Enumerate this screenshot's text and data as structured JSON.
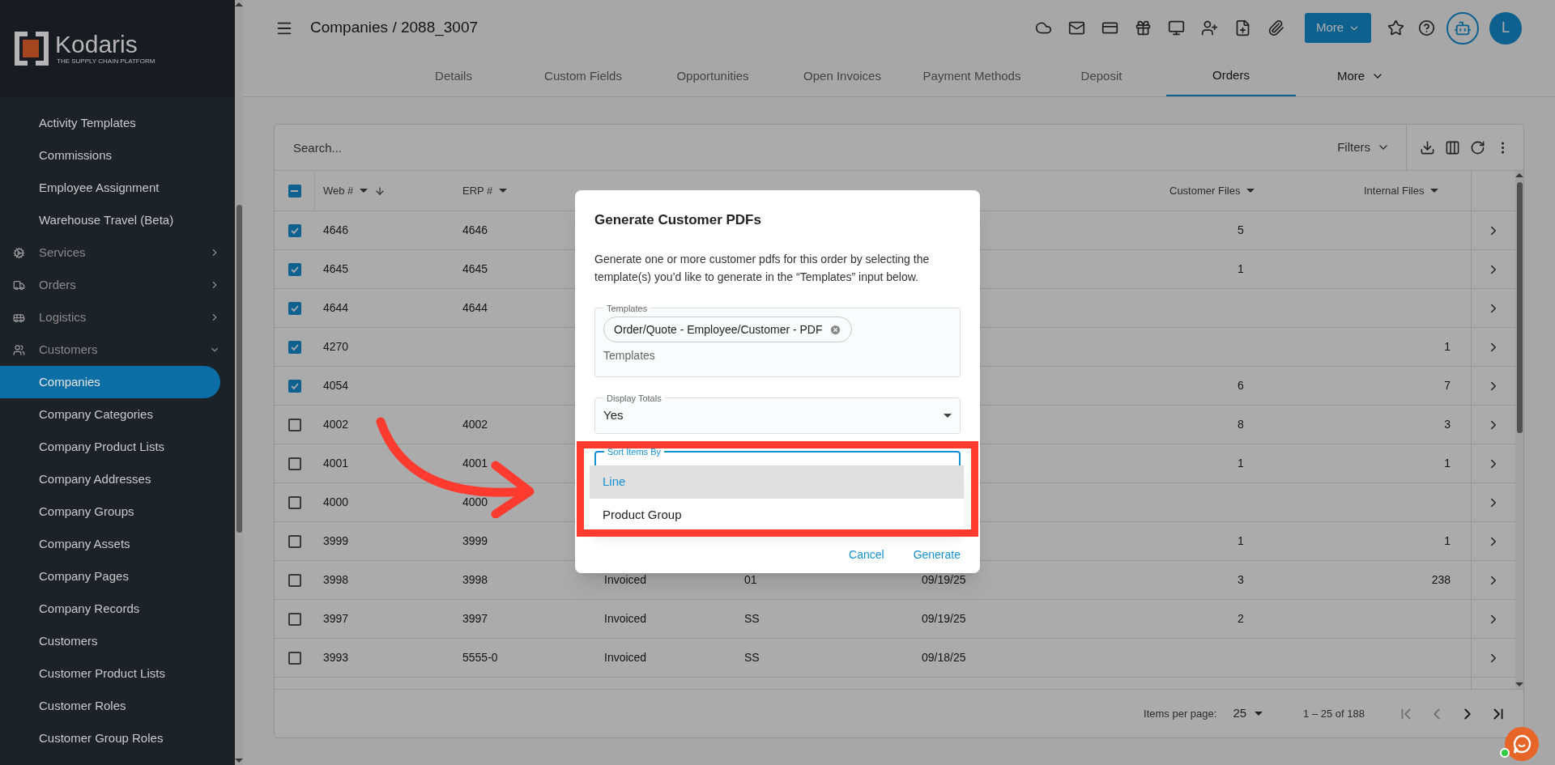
{
  "sidebar": {
    "logo": {
      "name": "Kodaris",
      "tagline": "THE SUPPLY CHAIN PLATFORM"
    },
    "items": [
      {
        "label": "Activity Templates",
        "kind": "link",
        "selected": false
      },
      {
        "label": "Commissions",
        "kind": "link",
        "selected": false
      },
      {
        "label": "Employee Assignment",
        "kind": "link",
        "selected": false
      },
      {
        "label": "Warehouse Travel (Beta)",
        "kind": "link",
        "selected": false
      },
      {
        "label": "Services",
        "kind": "group",
        "expanded": false
      },
      {
        "label": "Orders",
        "kind": "group",
        "expanded": false
      },
      {
        "label": "Logistics",
        "kind": "group",
        "expanded": false
      },
      {
        "label": "Customers",
        "kind": "group",
        "expanded": true,
        "children": [
          {
            "label": "Companies",
            "selected": true
          },
          {
            "label": "Company Categories",
            "selected": false
          },
          {
            "label": "Company Product Lists",
            "selected": false
          },
          {
            "label": "Company Addresses",
            "selected": false
          },
          {
            "label": "Company Groups",
            "selected": false
          },
          {
            "label": "Company Assets",
            "selected": false
          },
          {
            "label": "Company Pages",
            "selected": false
          },
          {
            "label": "Company Records",
            "selected": false
          },
          {
            "label": "Customers",
            "selected": false
          },
          {
            "label": "Customer Product Lists",
            "selected": false
          },
          {
            "label": "Customer Roles",
            "selected": false
          },
          {
            "label": "Customer Group Roles",
            "selected": false
          }
        ]
      }
    ]
  },
  "header": {
    "title": "Companies / 2088_3007",
    "more_button": "More",
    "avatar": "L"
  },
  "tabs": [
    {
      "label": "Details",
      "kind": "tab",
      "selected": false
    },
    {
      "label": "Custom Fields",
      "kind": "tab",
      "selected": false
    },
    {
      "label": "Opportunities",
      "kind": "tab",
      "selected": false
    },
    {
      "label": "Open Invoices",
      "kind": "tab",
      "selected": false
    },
    {
      "label": "Payment Methods",
      "kind": "tab",
      "selected": false
    },
    {
      "label": "Deposit",
      "kind": "tab",
      "selected": false
    },
    {
      "label": "Orders",
      "kind": "tab",
      "selected": true
    },
    {
      "label": "More",
      "kind": "menu",
      "selected": false
    }
  ],
  "table": {
    "search": {
      "placeholder": "Search..."
    },
    "filters": "Filters",
    "select_all_partial": true,
    "columns": [
      {
        "label": "Web #",
        "sort_arrow": true
      },
      {
        "label": "ERP #",
        "sort_arrow": false
      },
      null,
      null,
      null,
      {
        "label": "Customer Files",
        "sort_arrow": false
      },
      {
        "label": "Internal Files",
        "sort_arrow": false
      }
    ],
    "rows": [
      {
        "checked": true,
        "web": "4646",
        "erp": "4646",
        "customer_files": "5"
      },
      {
        "checked": true,
        "web": "4645",
        "erp": "4645",
        "customer_files": "1"
      },
      {
        "checked": true,
        "web": "4644",
        "erp": "4644"
      },
      {
        "checked": true,
        "web": "4270",
        "internal_files": "1"
      },
      {
        "checked": true,
        "web": "4054",
        "customer_files": "6",
        "internal_files": "7"
      },
      {
        "checked": false,
        "web": "4002",
        "erp": "4002",
        "customer_files": "8",
        "internal_files": "3"
      },
      {
        "checked": false,
        "web": "4001",
        "erp": "4001",
        "customer_files": "1",
        "internal_files": "1"
      },
      {
        "checked": false,
        "web": "4000",
        "erp": "4000"
      },
      {
        "checked": false,
        "web": "3999",
        "erp": "3999",
        "customer_files": "1",
        "internal_files": "1"
      },
      {
        "checked": false,
        "web": "3998",
        "erp": "3998",
        "status": "Invoiced",
        "warehouse": "01",
        "completed": "09/19/25",
        "customer_files": "3",
        "internal_files": "238"
      },
      {
        "checked": false,
        "web": "3997",
        "erp": "3997",
        "status": "Invoiced",
        "warehouse": "SS",
        "completed": "09/19/25",
        "customer_files": "2"
      },
      {
        "checked": false,
        "web": "3993",
        "erp": "5555-0",
        "status": "Invoiced",
        "warehouse": "SS",
        "completed": "09/18/25"
      }
    ],
    "footer": {
      "items_per_page_label": "Items per page:",
      "page_size": "25",
      "range": "1 – 25 of 188",
      "first_disabled": true,
      "prev_disabled": true,
      "next_disabled": false,
      "last_disabled": false
    }
  },
  "dialog": {
    "title": "Generate Customer PDFs",
    "description": "Generate one or more customer pdfs for this order by selecting the template(s) you’d like to generate in the “Templates” input below.",
    "templates": {
      "label": "Templates",
      "chips": [
        "Order/Quote - Employee/Customer - PDF"
      ],
      "placeholder": "Templates"
    },
    "display_totals": {
      "label": "Display Totals",
      "value": "Yes"
    },
    "sort_items_by": {
      "label": "Sort Items By",
      "options": [
        {
          "label": "Line",
          "selected": true
        },
        {
          "label": "Product Group",
          "selected": false
        }
      ]
    },
    "buttons": [
      "Cancel",
      "Generate"
    ]
  }
}
